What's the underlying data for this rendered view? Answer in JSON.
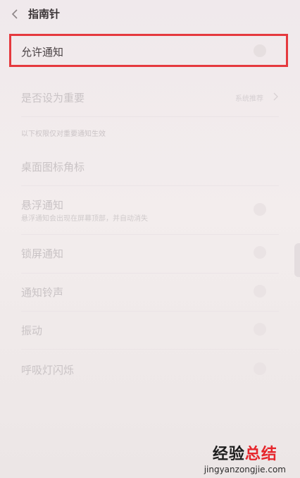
{
  "header": {
    "title": "指南针"
  },
  "allow": {
    "label": "允许通知"
  },
  "important": {
    "label": "是否设为重要",
    "value": "系统推荐"
  },
  "section": {
    "label": "以下权限仅对重要通知生效"
  },
  "items": [
    {
      "label": "桌面图标角标"
    },
    {
      "label": "悬浮通知",
      "sub": "悬浮通知会出现在屏幕顶部，并自动消失"
    },
    {
      "label": "锁屏通知"
    },
    {
      "label": "通知铃声"
    },
    {
      "label": "振动"
    },
    {
      "label": "呼吸灯闪烁"
    }
  ],
  "watermark": {
    "part1": "经验",
    "part2": "总结",
    "url": "jingyanzongjie.com"
  },
  "colors": {
    "highlight": "#e5393e",
    "wm_part1": "#1e1e1e",
    "wm_part2": "#e6262c"
  },
  "icons": {
    "back": "chevron-left-icon",
    "chevron": "chevron-right-icon"
  }
}
